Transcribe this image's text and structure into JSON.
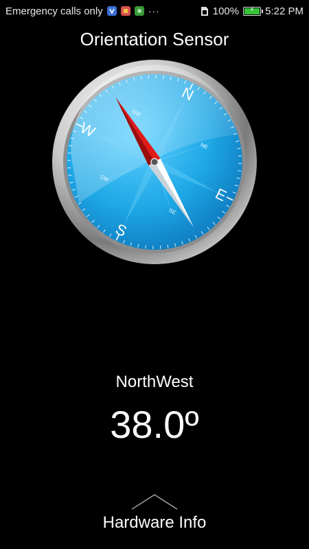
{
  "status_bar": {
    "carrier_text": "Emergency calls only",
    "notification_icons": [
      "vpn-icon",
      "app-notification-icon",
      "android-icon"
    ],
    "more_text": "···",
    "battery_percent": "100%",
    "battery_level": 1.0,
    "time": "5:22 PM"
  },
  "title": "Orientation Sensor",
  "compass": {
    "cardinals": {
      "n": "N",
      "e": "E",
      "s": "S",
      "w": "W"
    },
    "intercardinals": {
      "ne": "NE",
      "se": "SE",
      "sw": "SW",
      "nw": "NW"
    },
    "heading_degrees": -38
  },
  "reading": {
    "direction": "NorthWest",
    "degrees": "38.0º"
  },
  "footer": {
    "hardware_info_label": "Hardware Info"
  },
  "colors": {
    "background": "#000000",
    "dial_blue": "#1ea8e6",
    "needle_red": "#e11a1a",
    "needle_white": "#ffffff",
    "battery_green": "#37c237"
  }
}
